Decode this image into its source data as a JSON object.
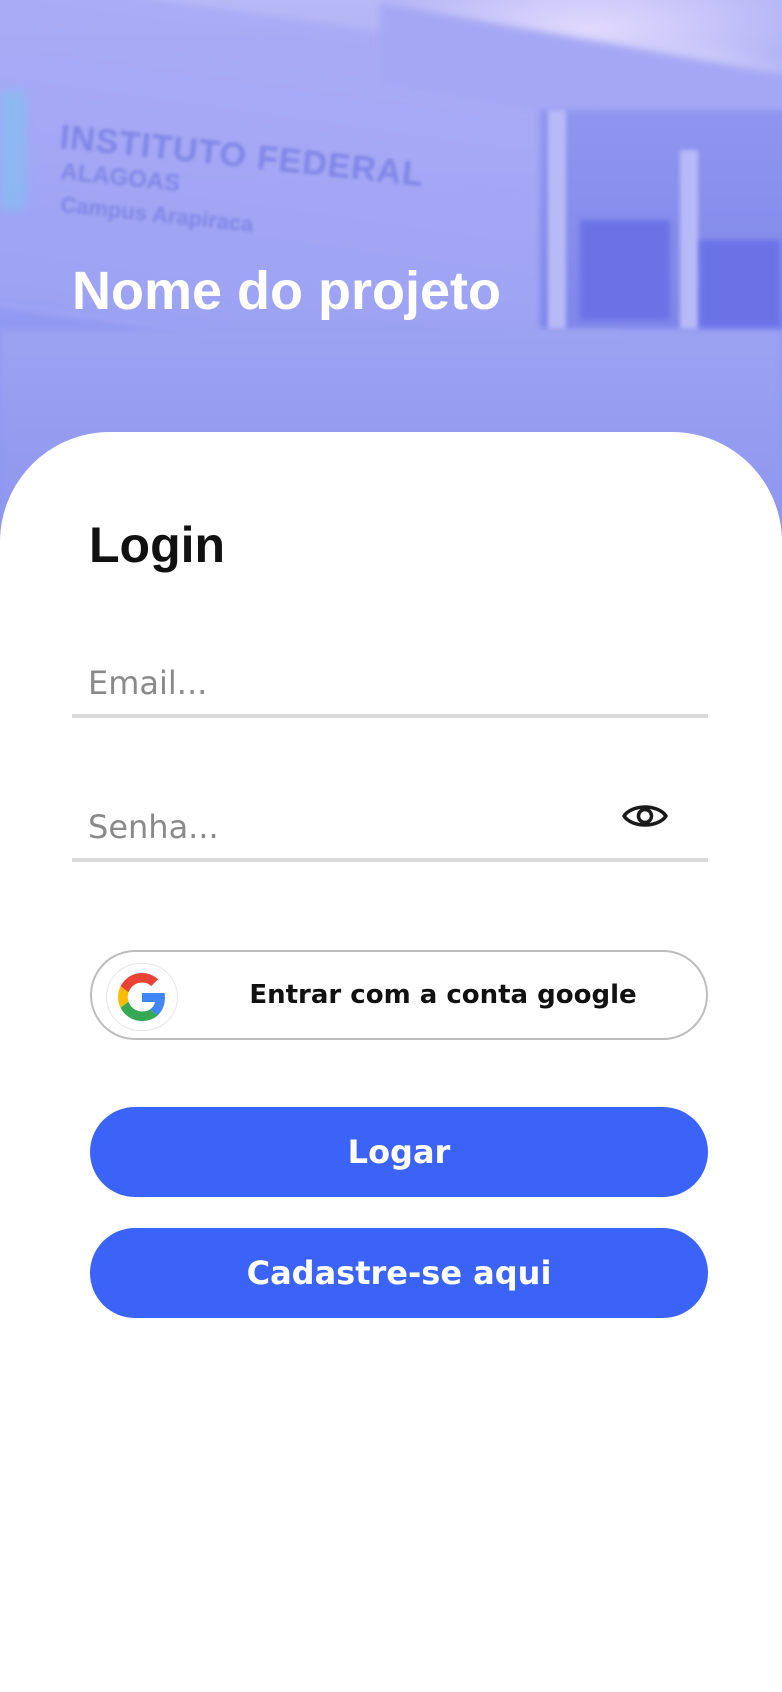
{
  "hero": {
    "project_title": "Nome do projeto",
    "facade_sign": {
      "line1": "INSTITUTO FEDERAL",
      "line2": "ALAGOAS",
      "line3": "Campus Arapiraca"
    }
  },
  "login": {
    "heading": "Login",
    "email_placeholder": "Email...",
    "email_value": "",
    "password_placeholder": "Senha...",
    "password_value": "",
    "password_toggle_icon": "eye-icon",
    "google_button_label": "Entrar com a conta google",
    "google_icon": "google-logo-icon",
    "login_button_label": "Logar",
    "register_button_label": "Cadastre-se aqui"
  },
  "colors": {
    "primary": "#3c63f7",
    "hero_overlay": "#8f98f2",
    "field_underline": "#d9d9d9",
    "google_border": "#bdbdbd"
  }
}
